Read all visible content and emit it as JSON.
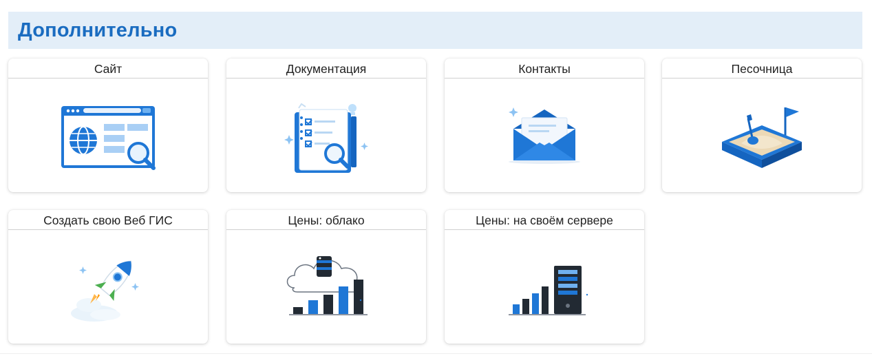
{
  "section": {
    "title": "Дополнительно"
  },
  "cards": [
    {
      "title": "Сайт",
      "icon": "website-globe-icon"
    },
    {
      "title": "Документация",
      "icon": "documentation-checklist-icon"
    },
    {
      "title": "Контакты",
      "icon": "envelope-icon"
    },
    {
      "title": "Песочница",
      "icon": "sandbox-icon"
    },
    {
      "title": "Создать свою Веб ГИС",
      "icon": "rocket-icon"
    },
    {
      "title": "Цены: облако",
      "icon": "cloud-pricing-icon"
    },
    {
      "title": "Цены: на своём сервере",
      "icon": "server-pricing-icon"
    }
  ],
  "colors": {
    "accent": "#1a6cc0",
    "header_bg": "#e3eef8",
    "icon_blue": "#1f77d6",
    "icon_dark": "#222a33"
  }
}
